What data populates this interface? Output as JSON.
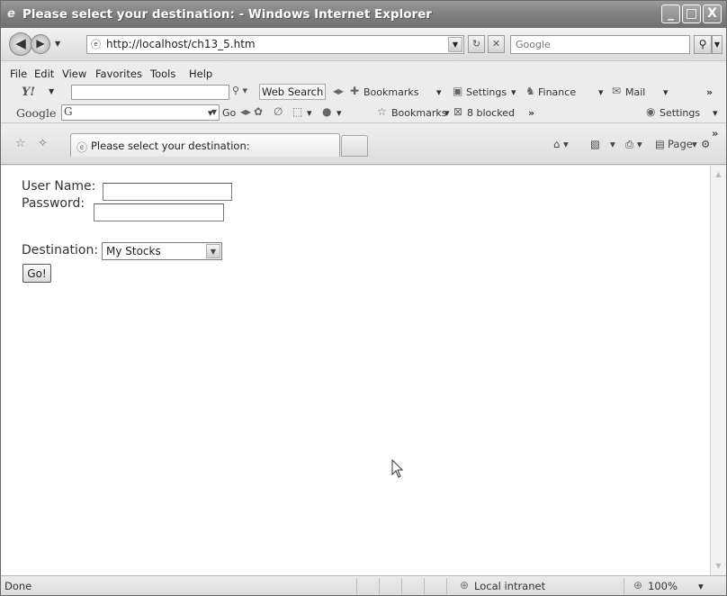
{
  "window": {
    "title": "Please select your destination: - Windows Internet Explorer",
    "minimize": "_",
    "maximize": "□",
    "close": "X"
  },
  "address_bar": {
    "url": "http://localhost/ch13_5.htm",
    "search_placeholder": "Google"
  },
  "menu": {
    "items": [
      "File",
      "Edit",
      "View",
      "Favorites",
      "Tools",
      "Help"
    ]
  },
  "yahoo_toolbar": {
    "logo": "Y!",
    "web_search": "Web Search",
    "bookmarks": "Bookmarks",
    "settings": "Settings",
    "finance": "Finance",
    "mail": "Mail",
    "more": "»"
  },
  "google_toolbar": {
    "logo": "Google",
    "box_mark": "G",
    "go": "Go",
    "bookmarks": "Bookmarks",
    "blocked": "8 blocked",
    "more": "»",
    "settings": "Settings"
  },
  "tab_bar": {
    "active_tab_title": "Please select your destination:",
    "page_label": "Page",
    "tools_label": "Tools",
    "more": "»"
  },
  "form": {
    "username_label": "User Name:",
    "password_label": "Password:",
    "destination_label": "Destination:",
    "destination_selected": "My Stocks",
    "go_button": "Go!"
  },
  "status_bar": {
    "status": "Done",
    "zone": "Local intranet",
    "zoom": "100%"
  },
  "icons": [
    "ie-logo-icon",
    "back-icon",
    "forward-icon",
    "page-icon",
    "refresh-icon",
    "stop-icon",
    "search-icon",
    "star-icon",
    "add-favorite-icon",
    "home-icon",
    "feeds-icon",
    "print-icon",
    "page-menu-icon",
    "tools-gear-icon",
    "cursor-arrow-icon",
    "globe-intranet-icon",
    "zoom-icon"
  ]
}
